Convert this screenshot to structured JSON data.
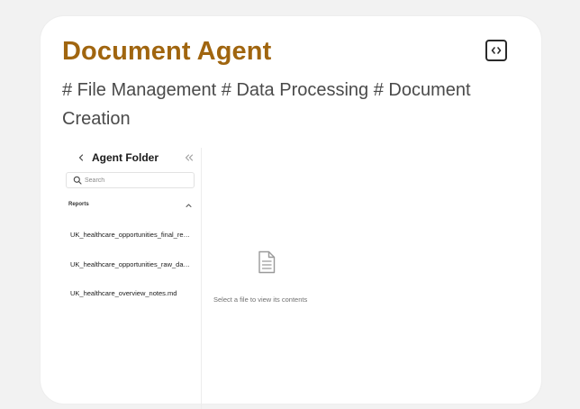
{
  "card": {
    "title": "Document Agent",
    "tags": "# File Management # Data Processing # Document Creation",
    "code_icon": "code-brackets-icon"
  },
  "folder_panel": {
    "title": "Agent Folder",
    "back_icon": "chevron-left-icon",
    "collapse_icon": "double-chevron-left-icon",
    "search": {
      "placeholder": "Search",
      "value": ""
    },
    "section": {
      "label": "Reports",
      "icon": "chevron-up-icon"
    },
    "files": [
      {
        "name": "UK_healthcare_opportunities_final_report.md"
      },
      {
        "name": "UK_healthcare_opportunities_raw_data.md"
      },
      {
        "name": "UK_healthcare_overview_notes.md"
      }
    ]
  },
  "viewer": {
    "icon": "document-icon",
    "empty_message": "Select a file to view its contents"
  },
  "colors": {
    "title": "#a0650f",
    "background": "#f2f2f2",
    "card": "#ffffff"
  }
}
